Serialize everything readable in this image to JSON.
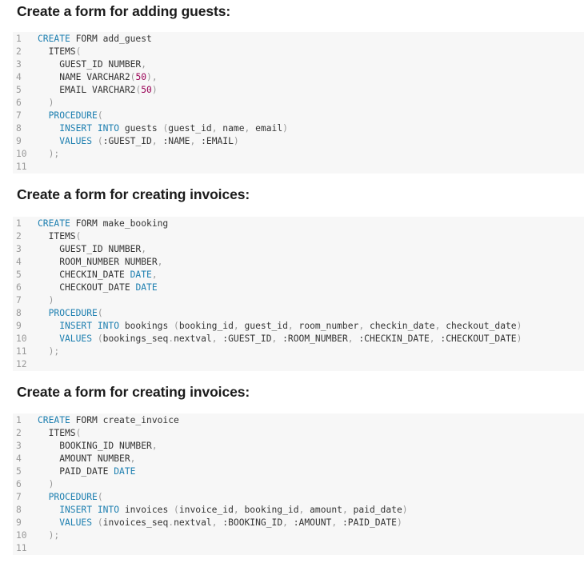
{
  "sections": [
    {
      "heading": "Create a form for adding guests:",
      "lines": [
        [
          [
            "kw",
            "CREATE"
          ],
          [
            "txt",
            " FORM add_guest"
          ]
        ],
        [
          [
            "txt",
            "  ITEMS"
          ],
          [
            "pun",
            "("
          ]
        ],
        [
          [
            "txt",
            "    GUEST_ID NUMBER"
          ],
          [
            "pun",
            ","
          ]
        ],
        [
          [
            "txt",
            "    NAME VARCHAR2"
          ],
          [
            "pun",
            "("
          ],
          [
            "num",
            "50"
          ],
          [
            "pun",
            "),"
          ]
        ],
        [
          [
            "txt",
            "    EMAIL VARCHAR2"
          ],
          [
            "pun",
            "("
          ],
          [
            "num",
            "50"
          ],
          [
            "pun",
            ")"
          ]
        ],
        [
          [
            "pun",
            "  )"
          ]
        ],
        [
          [
            "kw",
            "  PROCEDURE"
          ],
          [
            "pun",
            "("
          ]
        ],
        [
          [
            "kw",
            "    INSERT INTO"
          ],
          [
            "txt",
            " guests "
          ],
          [
            "pun",
            "("
          ],
          [
            "txt",
            "guest_id"
          ],
          [
            "pun",
            ","
          ],
          [
            "txt",
            " name"
          ],
          [
            "pun",
            ","
          ],
          [
            "txt",
            " email"
          ],
          [
            "pun",
            ")"
          ]
        ],
        [
          [
            "kw",
            "    VALUES"
          ],
          [
            "txt",
            " "
          ],
          [
            "pun",
            "("
          ],
          [
            "txt",
            ":GUEST_ID"
          ],
          [
            "pun",
            ","
          ],
          [
            "txt",
            " :NAME"
          ],
          [
            "pun",
            ","
          ],
          [
            "txt",
            " :EMAIL"
          ],
          [
            "pun",
            ")"
          ]
        ],
        [
          [
            "pun",
            "  );"
          ]
        ],
        []
      ]
    },
    {
      "heading": "Create a form for creating invoices:",
      "lines": [
        [
          [
            "kw",
            "CREATE"
          ],
          [
            "txt",
            " FORM make_booking"
          ]
        ],
        [
          [
            "txt",
            "  ITEMS"
          ],
          [
            "pun",
            "("
          ]
        ],
        [
          [
            "txt",
            "    GUEST_ID NUMBER"
          ],
          [
            "pun",
            ","
          ]
        ],
        [
          [
            "txt",
            "    ROOM_NUMBER NUMBER"
          ],
          [
            "pun",
            ","
          ]
        ],
        [
          [
            "txt",
            "    CHECKIN_DATE "
          ],
          [
            "kw",
            "DATE"
          ],
          [
            "pun",
            ","
          ]
        ],
        [
          [
            "txt",
            "    CHECKOUT_DATE "
          ],
          [
            "kw",
            "DATE"
          ]
        ],
        [
          [
            "pun",
            "  )"
          ]
        ],
        [
          [
            "kw",
            "  PROCEDURE"
          ],
          [
            "pun",
            "("
          ]
        ],
        [
          [
            "kw",
            "    INSERT INTO"
          ],
          [
            "txt",
            " bookings "
          ],
          [
            "pun",
            "("
          ],
          [
            "txt",
            "booking_id"
          ],
          [
            "pun",
            ","
          ],
          [
            "txt",
            " guest_id"
          ],
          [
            "pun",
            ","
          ],
          [
            "txt",
            " room_number"
          ],
          [
            "pun",
            ","
          ],
          [
            "txt",
            " checkin_date"
          ],
          [
            "pun",
            ","
          ],
          [
            "txt",
            " checkout_date"
          ],
          [
            "pun",
            ")"
          ]
        ],
        [
          [
            "kw",
            "    VALUES"
          ],
          [
            "txt",
            " "
          ],
          [
            "pun",
            "("
          ],
          [
            "txt",
            "bookings_seq"
          ],
          [
            "pun",
            "."
          ],
          [
            "txt",
            "nextval"
          ],
          [
            "pun",
            ","
          ],
          [
            "txt",
            " :GUEST_ID"
          ],
          [
            "pun",
            ","
          ],
          [
            "txt",
            " :ROOM_NUMBER"
          ],
          [
            "pun",
            ","
          ],
          [
            "txt",
            " :CHECKIN_DATE"
          ],
          [
            "pun",
            ","
          ],
          [
            "txt",
            " :CHECKOUT_DATE"
          ],
          [
            "pun",
            ")"
          ]
        ],
        [
          [
            "pun",
            "  );"
          ]
        ],
        []
      ]
    },
    {
      "heading": "Create a form for creating invoices:",
      "lines": [
        [
          [
            "kw",
            "CREATE"
          ],
          [
            "txt",
            " FORM create_invoice"
          ]
        ],
        [
          [
            "txt",
            "  ITEMS"
          ],
          [
            "pun",
            "("
          ]
        ],
        [
          [
            "txt",
            "    BOOKING_ID NUMBER"
          ],
          [
            "pun",
            ","
          ]
        ],
        [
          [
            "txt",
            "    AMOUNT NUMBER"
          ],
          [
            "pun",
            ","
          ]
        ],
        [
          [
            "txt",
            "    PAID_DATE "
          ],
          [
            "kw",
            "DATE"
          ]
        ],
        [
          [
            "pun",
            "  )"
          ]
        ],
        [
          [
            "kw",
            "  PROCEDURE"
          ],
          [
            "pun",
            "("
          ]
        ],
        [
          [
            "kw",
            "    INSERT INTO"
          ],
          [
            "txt",
            " invoices "
          ],
          [
            "pun",
            "("
          ],
          [
            "txt",
            "invoice_id"
          ],
          [
            "pun",
            ","
          ],
          [
            "txt",
            " booking_id"
          ],
          [
            "pun",
            ","
          ],
          [
            "txt",
            " amount"
          ],
          [
            "pun",
            ","
          ],
          [
            "txt",
            " paid_date"
          ],
          [
            "pun",
            ")"
          ]
        ],
        [
          [
            "kw",
            "    VALUES"
          ],
          [
            "txt",
            " "
          ],
          [
            "pun",
            "("
          ],
          [
            "txt",
            "invoices_seq"
          ],
          [
            "pun",
            "."
          ],
          [
            "txt",
            "nextval"
          ],
          [
            "pun",
            ","
          ],
          [
            "txt",
            " :BOOKING_ID"
          ],
          [
            "pun",
            ","
          ],
          [
            "txt",
            " :AMOUNT"
          ],
          [
            "pun",
            ","
          ],
          [
            "txt",
            " :PAID_DATE"
          ],
          [
            "pun",
            ")"
          ]
        ],
        [
          [
            "pun",
            "  );"
          ]
        ],
        []
      ]
    }
  ],
  "colors": {
    "keyword": "#1d7fb0",
    "number": "#990055",
    "punctuation": "#999999",
    "text": "#333333",
    "line_number": "#999999",
    "code_background": "#f7f7f7",
    "heading": "#1b1b1b"
  }
}
